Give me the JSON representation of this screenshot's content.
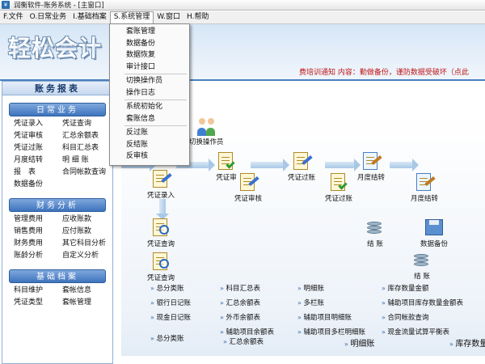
{
  "window": {
    "title": "润衡软件-账务系统 - [主窗口]",
    "app_icon": "app-logo-icon"
  },
  "menubar": [
    "F.文件",
    "O.日常业务",
    "I.基础档案",
    "S.系统管理",
    "W.窗口",
    "H.帮助"
  ],
  "banner": {
    "logo": "轻松会计",
    "ticker": "费培训通知 内容：勤做备份，谨防数据受破坏（点此"
  },
  "dropdown": {
    "group1": [
      "套账管理",
      "数据备份",
      "数据恢复",
      "审计接口"
    ],
    "group2": [
      "切换操作员",
      "操作日志"
    ],
    "group3": [
      "系统初始化",
      "套账信息"
    ],
    "group4": [
      "反过账",
      "反结账",
      "反审核"
    ]
  },
  "sidebar": {
    "title": "账务报表",
    "daily": {
      "title": "日常业务",
      "items": [
        "凭证录入",
        "凭证查询",
        "凭证审核",
        "汇总余额表",
        "凭证过账",
        "科目汇总表",
        "月度结转",
        "明 细 账",
        "报　表",
        "合同帐款查询",
        "数据备份"
      ]
    },
    "finance": {
      "title": "财务分析",
      "items": [
        "管理费用",
        "应收账款",
        "销售费用",
        "应付账款",
        "财务费用",
        "其它科目分析",
        "账龄分析",
        "自定义分析"
      ]
    },
    "basic": {
      "title": "基础档案",
      "items": [
        "科目维护",
        "套帐信息",
        "凭证类型",
        "套帐管理"
      ]
    }
  },
  "flow": {
    "switch_operator": "切换操作员",
    "voucher_entry": "凭证录入",
    "voucher_audit_top": "凭证审",
    "voucher_audit": "凭证审核",
    "voucher_post_top": "凭证过账",
    "voucher_post": "凭证过账",
    "monthly_close_top": "月度结转",
    "monthly_close": "月度结转",
    "voucher_query": "凭证查询",
    "voucher_query2": "凭证查询",
    "close_account": "结 账",
    "close_account2": "结 账",
    "data_backup": "数据备份"
  },
  "reports": [
    "总分类账",
    "科目汇总表",
    "明细账",
    "库存数量金额",
    "银行日记账",
    "汇总余额表",
    "多栏账",
    "辅助项目库存数量金额表",
    "现金日记账",
    "外币余额表",
    "辅助项目明细账",
    "合同帐款查询",
    "总分类账",
    "辅助项目余额表",
    "辅助项目多栏明细账",
    "现金流量试算平衡表",
    "汇总余额表",
    "明细账",
    "库存数量"
  ]
}
